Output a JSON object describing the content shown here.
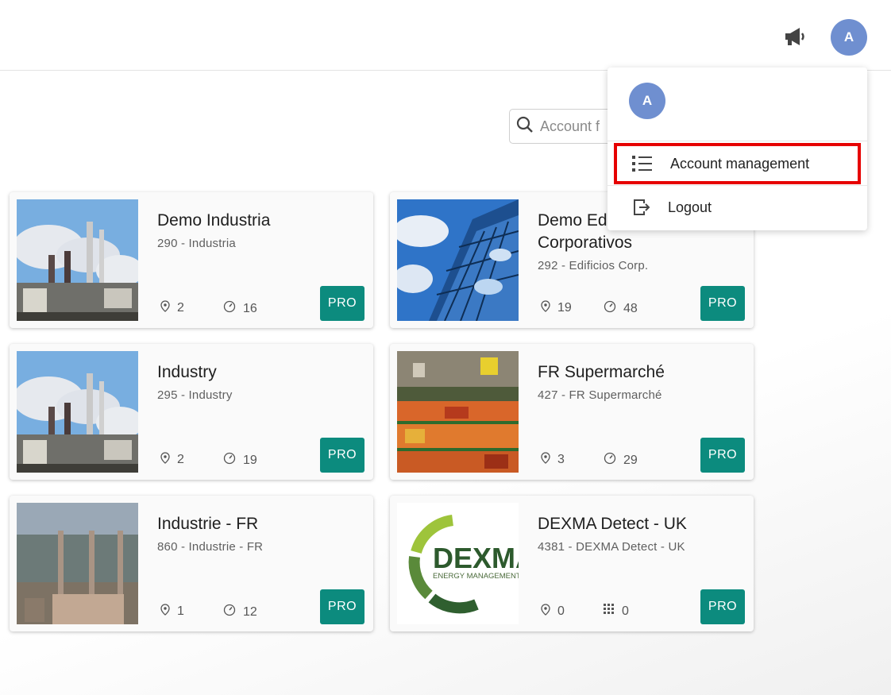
{
  "header": {
    "megaphone_icon": "megaphone-icon",
    "avatar_letter": "A",
    "avatar_color": "#6f8fd0"
  },
  "search": {
    "placeholder": "Account f",
    "icon": "search-icon"
  },
  "accounts": [
    {
      "title": "Demo Industria",
      "subtitle": "290 - Industria",
      "locations": "2",
      "meters": "16",
      "badge": "PRO"
    },
    {
      "title": "Demo Edificios Corporativos",
      "subtitle": "292 - Edificios Corp.",
      "locations": "19",
      "meters": "48",
      "badge": "PRO"
    },
    {
      "title": "Industry",
      "subtitle": "295 - Industry",
      "locations": "2",
      "meters": "19",
      "badge": "PRO"
    },
    {
      "title": "FR Supermarché",
      "subtitle": "427 - FR Supermarché",
      "locations": "3",
      "meters": "29",
      "badge": "PRO"
    },
    {
      "title": "Industrie - FR",
      "subtitle": "860 - Industrie - FR",
      "locations": "1",
      "meters": "12",
      "badge": "PRO"
    },
    {
      "title": "DEXMA Detect - UK",
      "subtitle": "4381 - DEXMA Detect - UK",
      "locations": "0",
      "meters": "0",
      "badge": "PRO"
    }
  ],
  "logo": {
    "name": "DEXMA",
    "tagline": "ENERGY MANAGEMENT"
  },
  "menu": {
    "avatar_letter": "A",
    "account_management_label": "Account management",
    "logout_label": "Logout",
    "highlight_color": "#e60000"
  },
  "colors": {
    "pro_badge": "#0c8b7e"
  }
}
